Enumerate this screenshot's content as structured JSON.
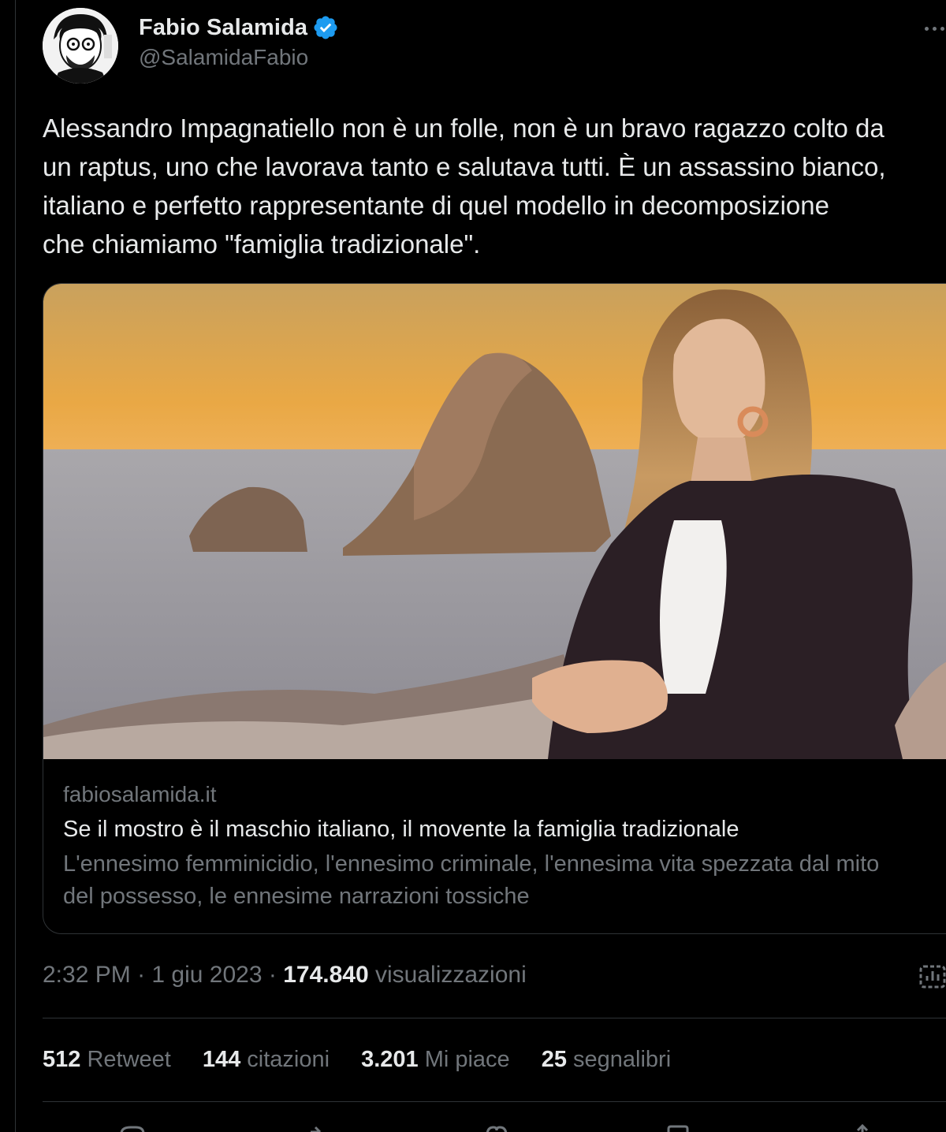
{
  "author": {
    "display_name": "Fabio Salamida",
    "handle": "@SalamidaFabio",
    "avatar_icon": "avatar",
    "verified_icon": "verified-badge-icon",
    "verified_color": "#1d9bf0"
  },
  "tweet": {
    "text": "Alessandro Impagnatiello non è un folle, non è un bravo ragazzo colto da\nun raptus, uno che lavorava tanto e salutava tutti. È un assassino bianco,\nitaliano e perfetto rappresentante di quel modello in decomposizione\nche chiamiamo \"famiglia tradizionale\"."
  },
  "card": {
    "domain": "fabiosalamida.it",
    "title": "Se il mostro è il maschio italiano, il movente la famiglia tradizionale",
    "description": "L'ennesimo femminicidio, l'ennesimo criminale, l'ennesima vita spezzata dal mito del possesso, le ennesime narrazioni tossiche"
  },
  "meta": {
    "time": "2:32 PM",
    "separator": " · ",
    "date": "1 giu 2023",
    "views_count": "174.840",
    "views_label": " visualizzazioni"
  },
  "stats": [
    {
      "num": "512",
      "label": " Retweet"
    },
    {
      "num": "144",
      "label": " citazioni"
    },
    {
      "num": "3.201",
      "label": " Mi piace"
    },
    {
      "num": "25",
      "label": " segnalibri"
    }
  ],
  "colors": {
    "background": "#000000",
    "text_primary": "#e7e9ea",
    "text_secondary": "#71767b",
    "border": "#2f3336"
  }
}
